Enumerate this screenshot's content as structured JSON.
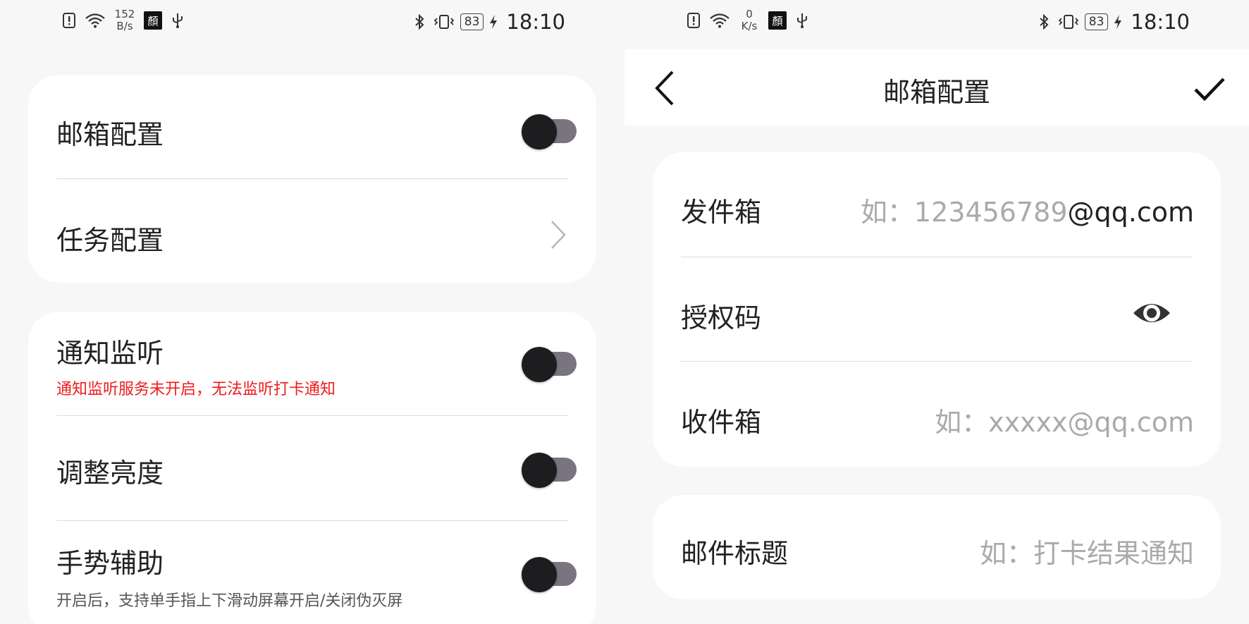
{
  "left": {
    "status_bar": {
      "net_speed_value": "152",
      "net_speed_unit": "B/s",
      "app_badge": "顏",
      "battery": "83",
      "time": "18:10"
    },
    "card1": {
      "email_config": {
        "label": "邮箱配置",
        "enabled": false
      },
      "task_config": {
        "label": "任务配置"
      }
    },
    "card2": {
      "notification_listen": {
        "label": "通知监听",
        "warning": "通知监听服务未开启，无法监听打卡通知",
        "enabled": false
      },
      "adjust_brightness": {
        "label": "调整亮度",
        "enabled": false
      },
      "gesture_assist": {
        "label": "手势辅助",
        "description": "开启后，支持单手指上下滑动屏幕开启/关闭伪灭屏",
        "enabled": false
      }
    }
  },
  "right": {
    "status_bar": {
      "net_speed_value": "0",
      "net_speed_unit": "K/s",
      "app_badge": "顏",
      "battery": "83",
      "time": "18:10"
    },
    "app_bar": {
      "title": "邮箱配置"
    },
    "form": {
      "sender": {
        "label": "发件箱",
        "placeholder": "如：123456789",
        "suffix": "@qq.com"
      },
      "auth_code": {
        "label": "授权码"
      },
      "receiver": {
        "label": "收件箱",
        "placeholder": "如：xxxxx@qq.com"
      },
      "mail_subject": {
        "label": "邮件标题",
        "placeholder": "如：打卡结果通知"
      }
    }
  },
  "colors": {
    "warning": "#f01b1b",
    "toggle_track": "#7a7380",
    "toggle_thumb": "#1d1d1f",
    "placeholder": "#aaaaaa"
  },
  "icons": [
    "alert-icon",
    "wifi-icon",
    "usb-icon",
    "bluetooth-icon",
    "vibrate-icon",
    "charging-icon",
    "chevron-right-icon",
    "back-arrow-icon",
    "check-icon",
    "eye-icon"
  ]
}
